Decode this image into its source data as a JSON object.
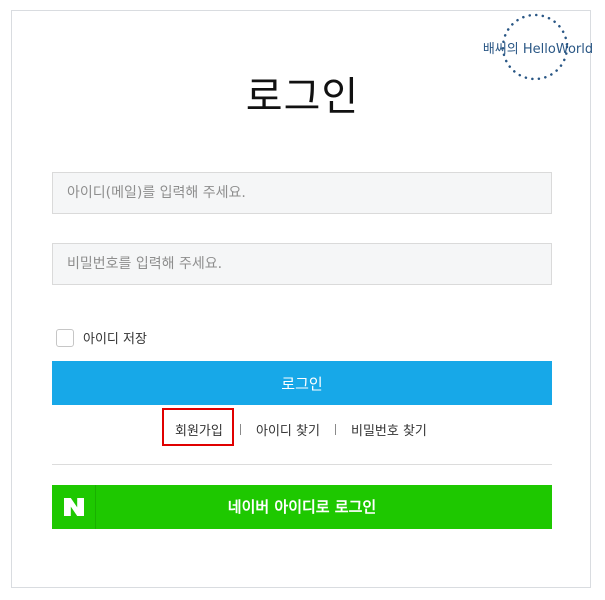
{
  "watermark": {
    "text": "배씨의 HelloWorld"
  },
  "page": {
    "title": "로그인"
  },
  "form": {
    "id_placeholder": "아이디(메일)를 입력해 주세요.",
    "id_value": "",
    "pw_placeholder": "비밀번호를 입력해 주세요.",
    "pw_value": "",
    "remember_label": "아이디 저장",
    "remember_checked": false,
    "login_label": "로그인"
  },
  "links": {
    "signup": "회원가입",
    "find_id": "아이디 찾기",
    "find_pw": "비밀번호 찾기"
  },
  "social": {
    "naver_label": "네이버 아이디로 로그인",
    "naver_icon": "naver-n-logo"
  },
  "colors": {
    "login_button": "#17a8e8",
    "naver_green": "#1ec800",
    "highlight": "#e00000",
    "watermark": "#2a5785"
  }
}
